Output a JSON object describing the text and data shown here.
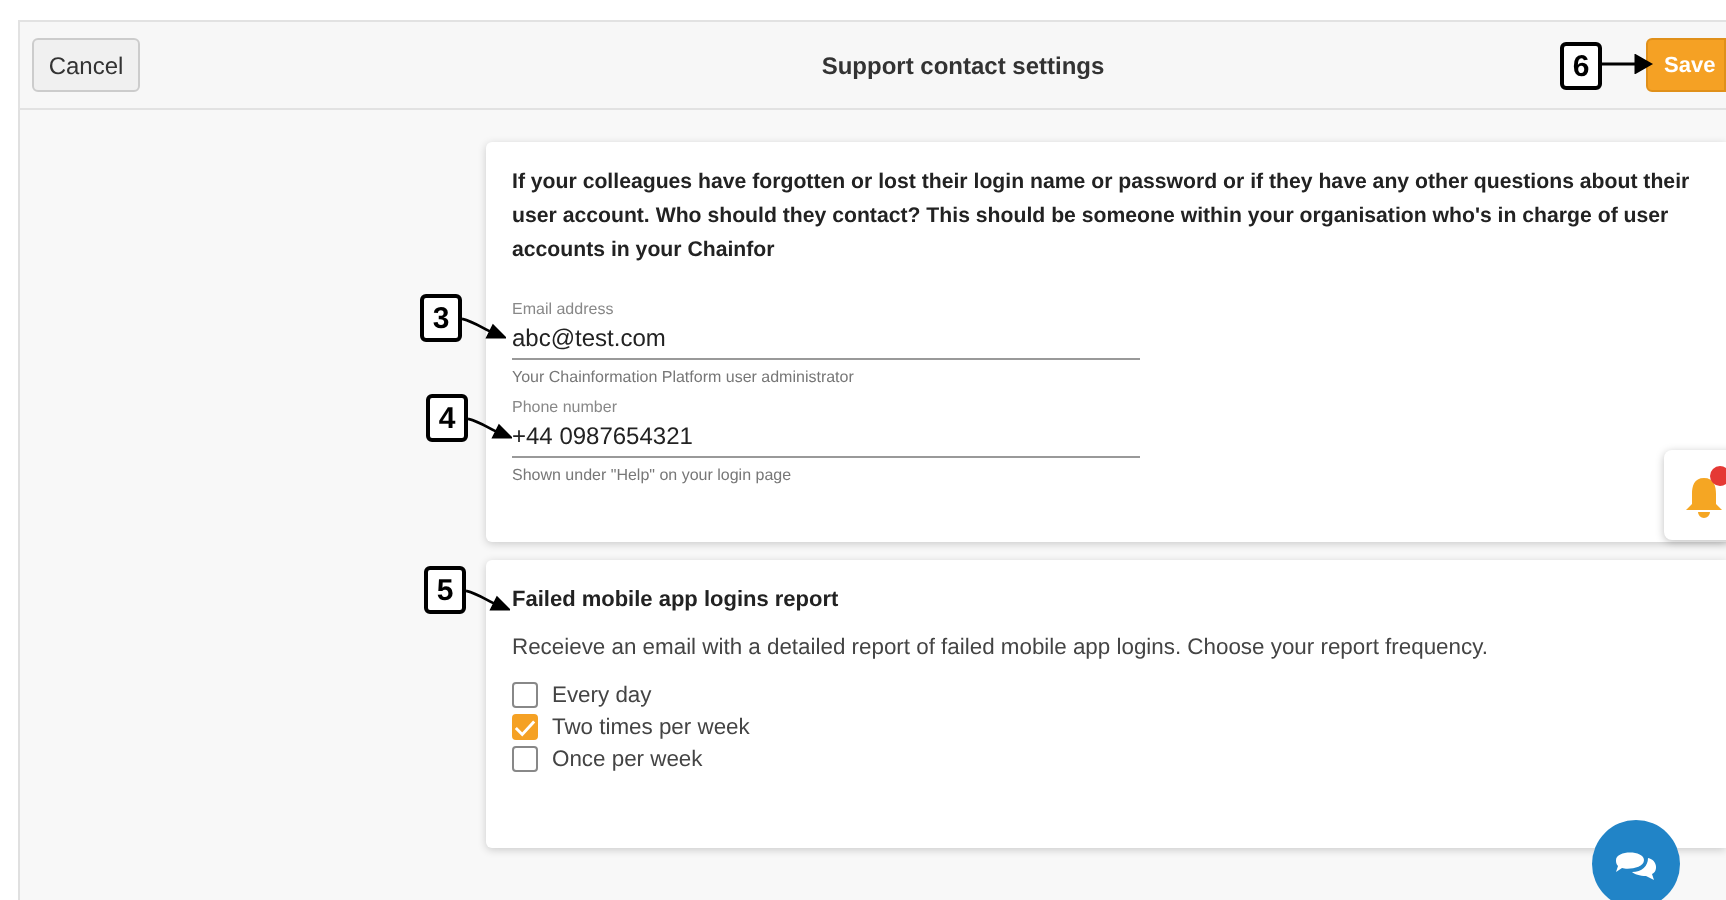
{
  "header": {
    "cancel_button": "Cancel",
    "title": "Support contact settings",
    "save_button": "Save"
  },
  "contact_card": {
    "intro": "If your colleagues have forgotten or lost their login name or password or if they have any other questions about their user account. Who should they contact? This should be someone within your organisation who's in charge of user accounts in your Chainfor",
    "fields": [
      {
        "label": "Email address",
        "value": "abc@test.com",
        "hint": "Your Chainformation Platform user administrator"
      },
      {
        "label": "Phone number",
        "value": "+44 0987654321",
        "hint": "Shown under \"Help\" on your login page"
      }
    ]
  },
  "report_card": {
    "title": "Failed mobile app logins report",
    "description": "Receieve an email with a detailed report of failed mobile app logins. Choose your report frequency.",
    "options": [
      {
        "label": "Every day",
        "checked": false
      },
      {
        "label": "Two times per week",
        "checked": true
      },
      {
        "label": "Once per week",
        "checked": false
      }
    ]
  },
  "callouts": [
    {
      "number": "3",
      "kind": "curved"
    },
    {
      "number": "4",
      "kind": "curved"
    },
    {
      "number": "5",
      "kind": "curved"
    },
    {
      "number": "6",
      "kind": "straight"
    }
  ]
}
